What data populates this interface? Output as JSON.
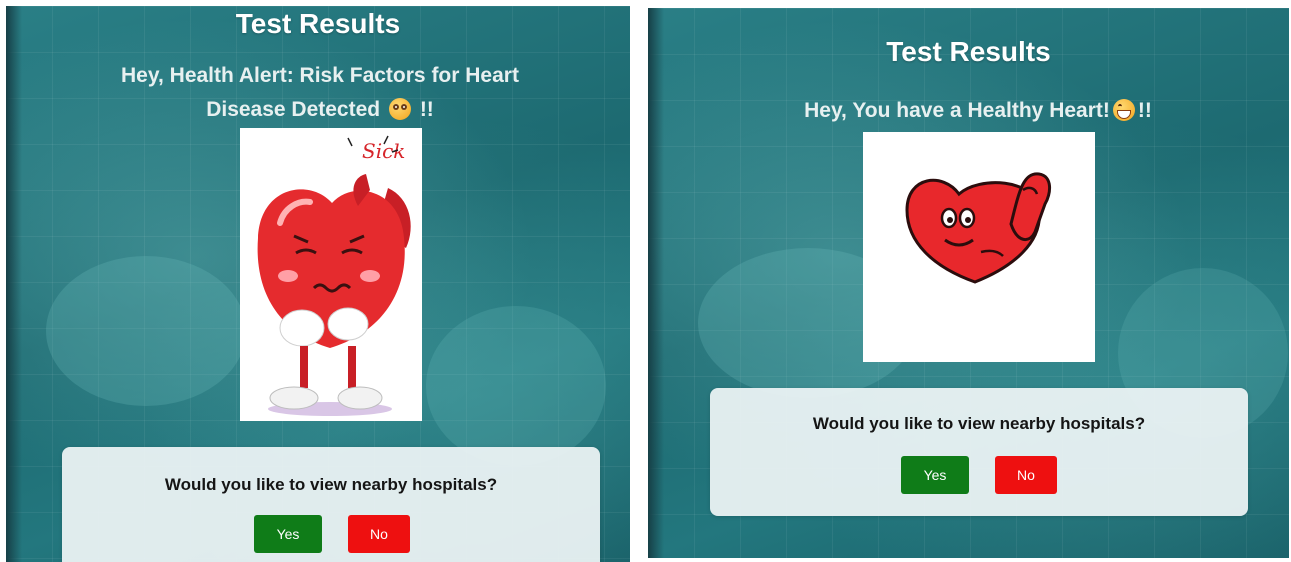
{
  "colors": {
    "yes_button": "#0f7c18",
    "no_button": "#ee1010",
    "panel_bg": "#1d6a71",
    "heart_red": "#e8282c"
  },
  "left_panel": {
    "title": "Test Results",
    "message_line1": "Hey, Health Alert: Risk Factors for Heart",
    "message_line2": "Disease Detected",
    "message_suffix": "!!",
    "message_emoji": "flushed-face-emoji",
    "image": "sick-heart-illustration",
    "image_caption": "Sick",
    "question": "Would you like to view nearby hospitals?",
    "yes_label": "Yes",
    "no_label": "No"
  },
  "right_panel": {
    "title": "Test Results",
    "message": "Hey, You have a Healthy Heart!",
    "message_suffix": "!!",
    "message_emoji": "grinning-face-emoji",
    "image": "strong-heart-illustration",
    "question": "Would you like to view nearby hospitals?",
    "yes_label": "Yes",
    "no_label": "No"
  }
}
